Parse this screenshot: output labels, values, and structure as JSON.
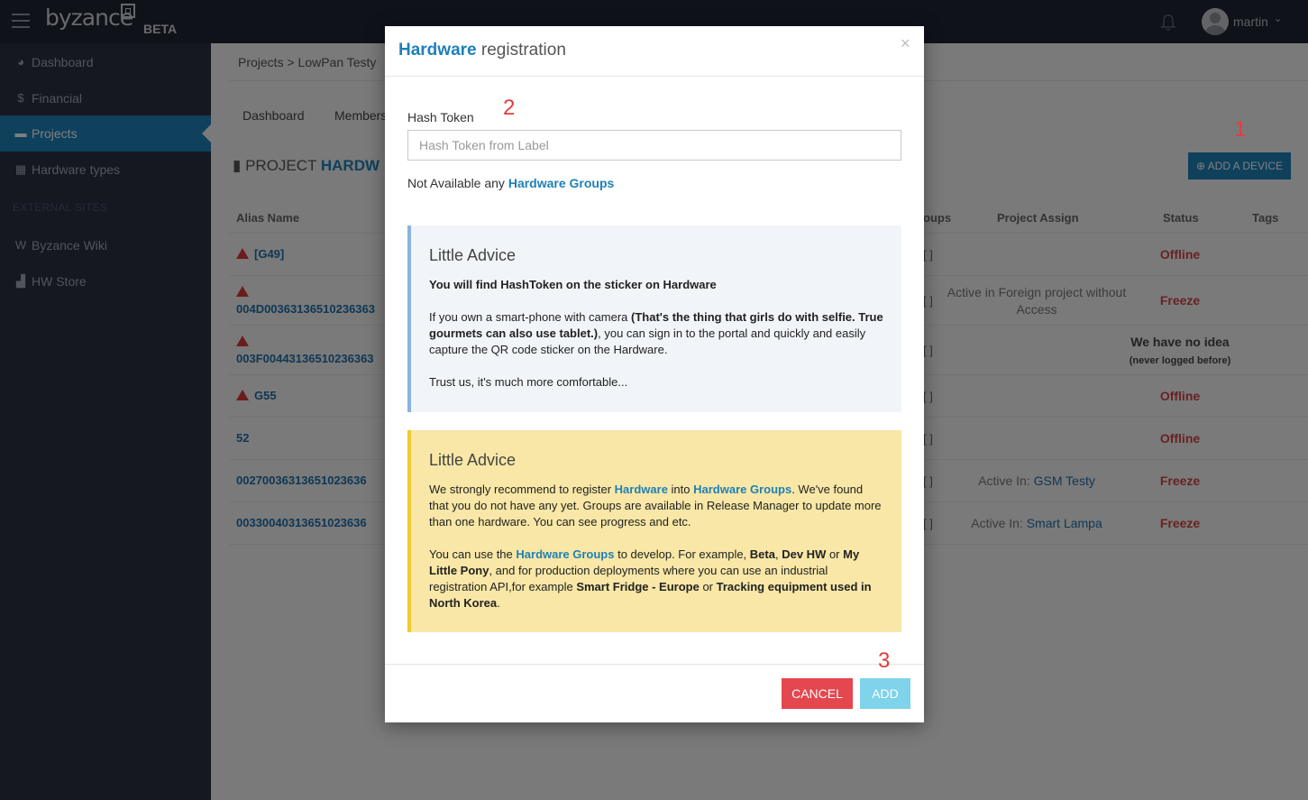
{
  "app": {
    "logo": "byzance",
    "badge": "BETA",
    "username": "martin"
  },
  "sidebar": {
    "items": [
      {
        "label": "Dashboard",
        "icon": "dashboard-icon"
      },
      {
        "label": "Financial",
        "icon": "dollar-icon"
      },
      {
        "label": "Projects",
        "icon": "briefcase-icon"
      },
      {
        "label": "Hardware types",
        "icon": "chip-icon"
      }
    ],
    "external_heading": "EXTERNAL SITES",
    "external": [
      {
        "label": "Byzance Wiki",
        "icon": "wiki-icon"
      },
      {
        "label": "HW Store",
        "icon": "cart-icon"
      }
    ]
  },
  "main": {
    "breadcrumb": "Projects  >  LowPan Testy",
    "tabs": [
      "Dashboard",
      "Members"
    ],
    "page_title_prefix": "PROJECT",
    "page_title_name": "HARDW",
    "add_device_label": "ADD A DEVICE",
    "columns": [
      "Alias Name",
      "oups",
      "Project Assign",
      "Status",
      "Tags"
    ],
    "rows": [
      {
        "alias": "[G49]",
        "bracket": "[ ]",
        "assign": "",
        "assign_link": "",
        "status": "Offline"
      },
      {
        "alias": "004D00363136510236363",
        "bracket": "[ ]",
        "assign": "Active in Foreign project without Access",
        "assign_link": "",
        "status": "Freeze"
      },
      {
        "alias": "003F00443136510236363",
        "bracket": "[ ]",
        "assign": "",
        "assign_link": "",
        "status": "We have no idea",
        "status_note": "(never logged before)"
      },
      {
        "alias": "G55",
        "bracket": "[ ]",
        "assign": "",
        "assign_link": "",
        "status": "Offline"
      },
      {
        "alias": "52",
        "bracket": "[ ]",
        "assign": "",
        "assign_link": "",
        "status": "Offline"
      },
      {
        "alias": "00270036313651023636",
        "bracket": "[ ]",
        "assign": "Active In:",
        "assign_link": "GSM Testy",
        "status": "Freeze"
      },
      {
        "alias": "00330040313651023636",
        "bracket": "[ ]",
        "assign": "Active In:",
        "assign_link": "Smart Lampa",
        "status": "Freeze"
      }
    ]
  },
  "annotations": [
    "1",
    "2",
    "3"
  ],
  "modal": {
    "title_bold": "Hardware",
    "title_rest": "registration",
    "close": "×",
    "field_label": "Hash Token",
    "field_placeholder": "Hash Token from Label",
    "field_value": "",
    "no_groups_text": "Not Available any",
    "no_groups_link": "Hardware Groups",
    "advice_blue": {
      "heading": "Little Advice",
      "bold_line": "You will find HashToken on the sticker on Hardware",
      "p2_a": "If you own a smart-phone with camera ",
      "p2_b": "(That's the thing that girls do with selfie. True gourmets can also use tablet.)",
      "p2_c": ", you can sign in to the portal and quickly and easily capture the QR code sticker on the Hardware.",
      "p3": "Trust us, it's much more comfortable..."
    },
    "advice_yellow": {
      "heading": "Little Advice",
      "p1_a": "We strongly recommend to register ",
      "p1_link1": "Hardware",
      "p1_b": " into ",
      "p1_link2": "Hardware Groups",
      "p1_c": ". We've found that you do not have any yet. Groups are available in Release Manager to update more than one hardware. You can see progress and etc.",
      "p2_a": "You can use the ",
      "p2_link": "Hardware Groups",
      "p2_b": " to develop. For example, ",
      "p2_beta": "Beta",
      "p2_sep1": ", ",
      "p2_devhw": "Dev HW",
      "p2_or": " or ",
      "p2_pony": "My Little Pony",
      "p2_c": ", and for production deployments where you can use an industrial registration API,for example ",
      "p2_fridge": "Smart Fridge - Europe",
      "p2_or2": " or ",
      "p2_tracking": "Tracking equipment used in North Korea",
      "p2_end": "."
    },
    "cancel_label": "CANCEL",
    "add_label": "ADD"
  },
  "colors": {
    "accent": "#1f80b8",
    "sidebar": "#2a3142",
    "topbar": "#1e2432",
    "danger": "#e5474e",
    "add_disabled": "#7fd3ea",
    "status_red": "#d34545"
  }
}
